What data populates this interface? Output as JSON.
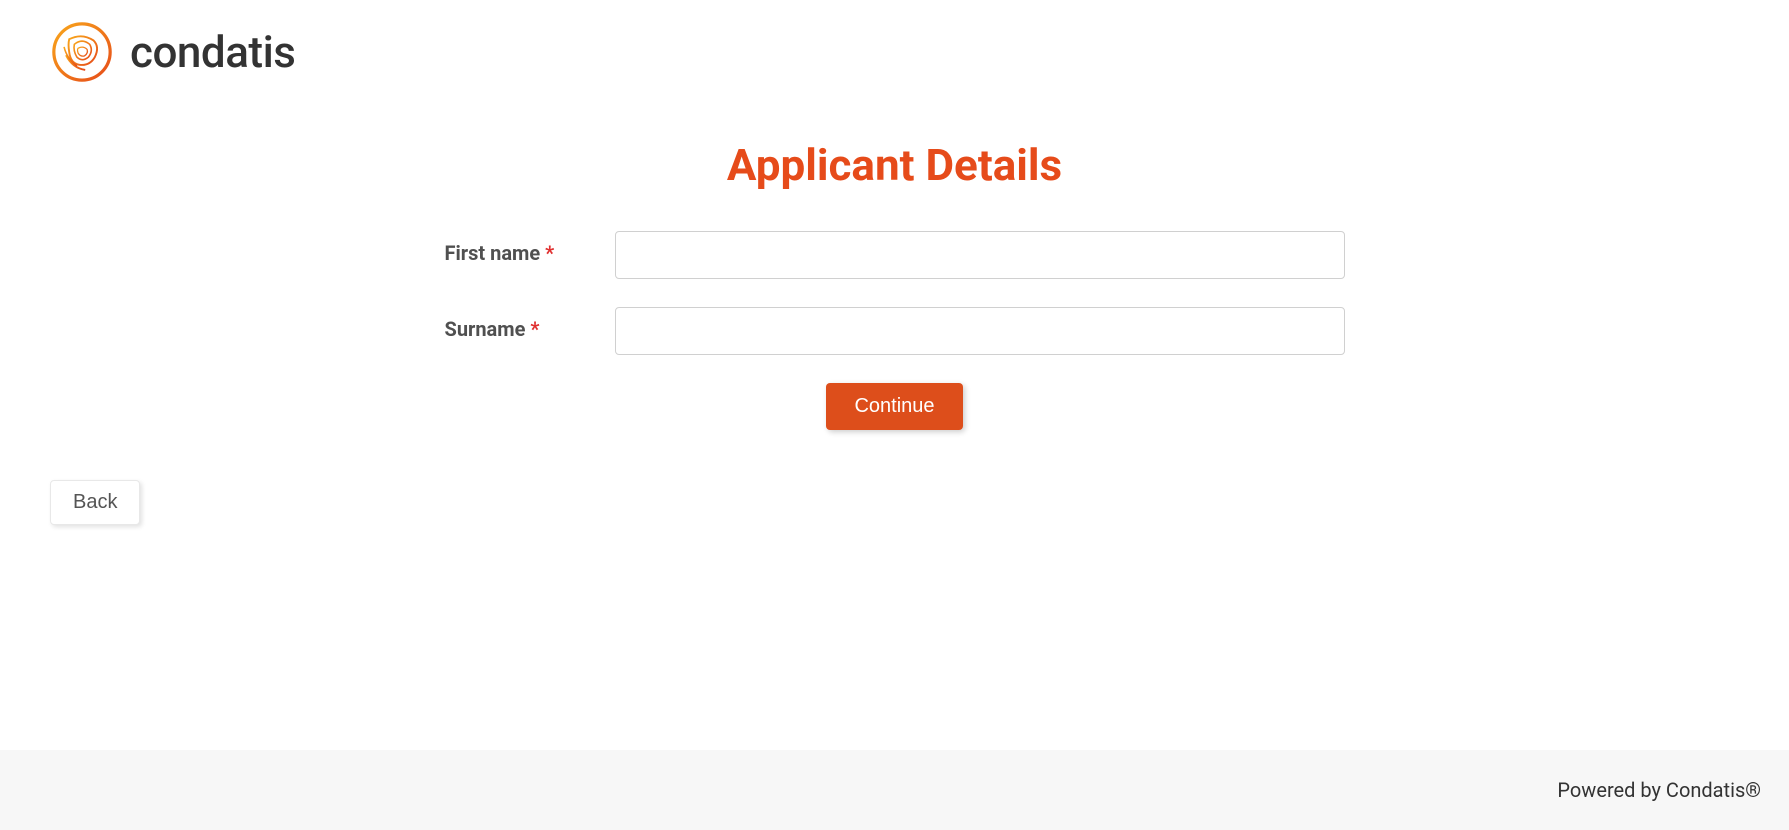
{
  "brand": {
    "name": "condatis"
  },
  "page": {
    "title": "Applicant Details"
  },
  "form": {
    "fields": [
      {
        "label": "First name",
        "required": "*",
        "value": ""
      },
      {
        "label": "Surname",
        "required": "*",
        "value": ""
      }
    ],
    "continue_label": "Continue"
  },
  "nav": {
    "back_label": "Back"
  },
  "footer": {
    "text": "Powered by Condatis®"
  }
}
